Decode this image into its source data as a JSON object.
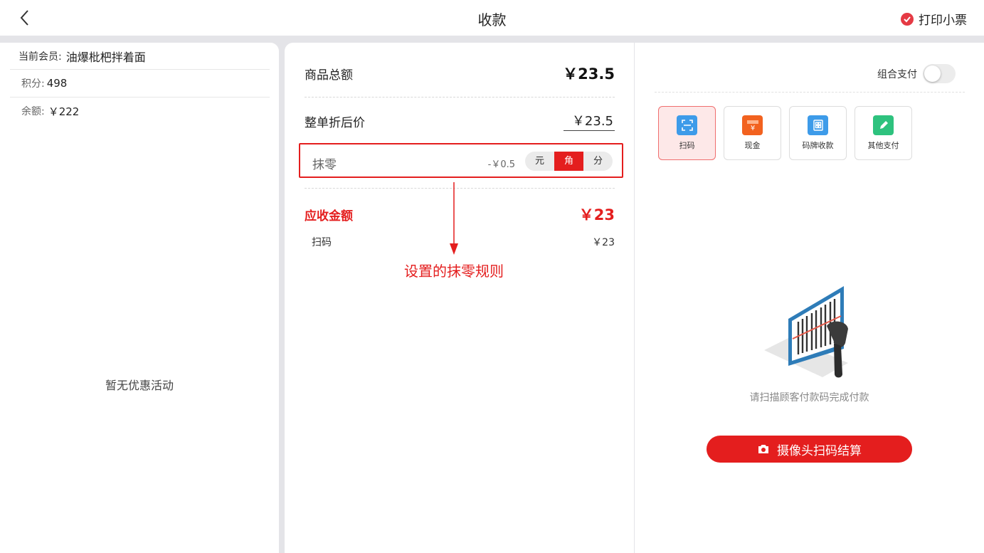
{
  "header": {
    "title": "收款",
    "print_receipt": "打印小票"
  },
  "member": {
    "label": "当前会员:",
    "name": "油爆枇杷拌着面",
    "points_label": "积分:",
    "points": "498",
    "balance_label": "余额:",
    "balance": "￥222",
    "no_promotion": "暂无优惠活动"
  },
  "summary": {
    "total_label": "商品总额",
    "total_value": "￥23.5",
    "discount_label": "整单折后价",
    "discount_value": "￥23.5",
    "rounding_label": "抹零",
    "rounding_amount": "-￥0.5",
    "rounding_options": [
      "元",
      "角",
      "分"
    ],
    "rounding_selected": "角",
    "due_label": "应收金额",
    "due_value": "￥23",
    "pay_method_label": "扫码",
    "pay_method_value": "￥23"
  },
  "annotation": {
    "text": "设置的抹零规则"
  },
  "payment": {
    "combo_label": "组合支付",
    "combo_enabled": false,
    "methods": [
      {
        "label": "扫码",
        "icon": "scan-icon",
        "color": "#3d9be9",
        "active": true
      },
      {
        "label": "现金",
        "icon": "cash-icon",
        "color": "#f2621f",
        "active": false
      },
      {
        "label": "码牌收款",
        "icon": "qr-plate-icon",
        "color": "#3d9be9",
        "active": false
      },
      {
        "label": "其他支付",
        "icon": "pencil-icon",
        "color": "#2ec27e",
        "active": false
      }
    ],
    "scan_hint": "请扫描顾客付款码完成付款",
    "camera_button": "摄像头扫码结算"
  },
  "colors": {
    "accent": "#e41e1e",
    "check": "#e53a44"
  }
}
